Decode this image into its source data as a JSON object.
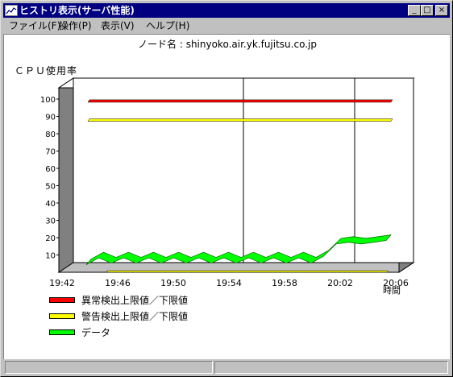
{
  "window": {
    "title": "ヒストリ表示(サーバ性能)",
    "buttons": {
      "minimize": "_",
      "maximize": "□",
      "close": "×"
    }
  },
  "menu": [
    {
      "label": "ファイル(F)"
    },
    {
      "label": "操作(P)"
    },
    {
      "label": "表示(V)"
    },
    {
      "label": "ヘルプ(H)"
    }
  ],
  "node_label": "ノード名 : shinyoko.air.yk.fujitsu.co.jp",
  "chart_data": {
    "type": "line",
    "ylabel": "ＣＰＵ使用率",
    "xlabel": "時間",
    "ylim": [
      0,
      100
    ],
    "yticks": [
      "100",
      "90",
      "80",
      "70",
      "60",
      "50",
      "40",
      "30",
      "20",
      "10"
    ],
    "xticks": [
      "19:42",
      "19:46",
      "19:50",
      "19:54",
      "19:58",
      "20:02",
      "20:06"
    ],
    "grid": true,
    "series": [
      {
        "name": "異常検出上限値／下限値",
        "color": "#ff0000",
        "upper": 94,
        "lower": 0
      },
      {
        "name": "警告検出上限値／下限値",
        "color": "#ffff00",
        "upper": 83,
        "lower": 0
      },
      {
        "name": "データ",
        "color": "#00ff00",
        "x": [
          "19:42",
          "19:43",
          "19:44",
          "19:45",
          "19:46",
          "19:47",
          "19:48",
          "19:49",
          "19:50",
          "19:51",
          "19:52",
          "19:53",
          "19:54",
          "19:55",
          "19:56",
          "19:57",
          "19:58",
          "19:59",
          "20:00",
          "20:01",
          "20:02",
          "20:03",
          "20:04",
          "20:05",
          "20:06"
        ],
        "values": [
          2,
          6,
          3,
          6,
          3,
          6,
          3,
          6,
          3,
          6,
          3,
          6,
          3,
          6,
          3,
          6,
          3,
          6,
          3,
          7,
          14,
          15,
          14,
          15,
          16
        ]
      }
    ],
    "legend_position": "bottom-left"
  }
}
